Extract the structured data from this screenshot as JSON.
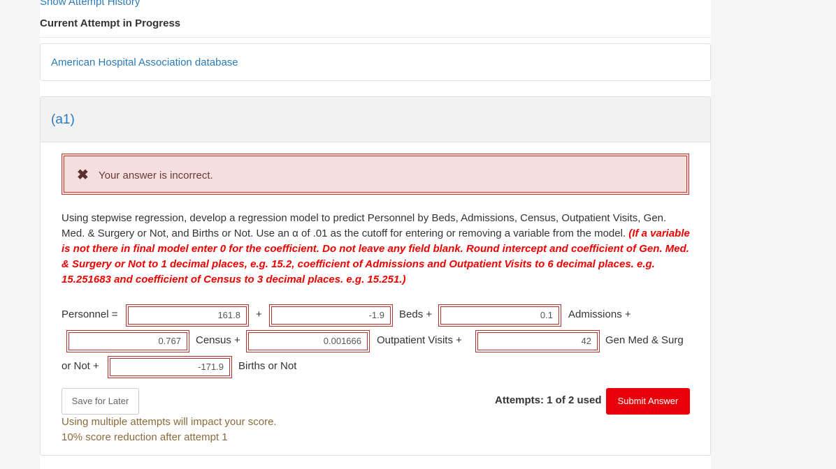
{
  "header": {
    "history_link": "Show Attempt History",
    "attempt_title": "Current Attempt in Progress"
  },
  "resource": {
    "link_label": "American Hospital Association database"
  },
  "question": {
    "part_label": "(a1)",
    "alert_icon": "close-icon",
    "alert_text": "Your answer is incorrect.",
    "prompt_text": "Using stepwise regression, develop a regression model to predict Personnel by Beds, Admissions, Census, Outpatient Visits, Gen. Med. & Surgery or Not, and Births or Not. Use an α of .01 as the cutoff for entering or removing a variable from the model.",
    "instruction_text": "(If a variable is not there in final model enter 0 for the coefficient. Do not leave any field blank. Round intercept and coefficient of Gen. Med. & Surgery or Not to 1 decimal places, e.g. 15.2, coefficient of Admissions and Outpatient Visits to 6 decimal places. e.g. 15.251683 and coefficient of Census to 3 decimal places. e.g. 15.251.)"
  },
  "equation": {
    "label_personnel": "Personnel =",
    "intercept_value": "161.8",
    "label_plus": "+",
    "beds_value": "-1.9",
    "label_beds": "Beds +",
    "admissions_value": "0.1",
    "label_admissions": "Admissions +",
    "census_value": "0.767",
    "label_census": "Census +",
    "outpatient_value": "0.001666",
    "label_outpatient": "Outpatient Visits +",
    "genmed_value": "42",
    "label_genmed": "Gen Med & Surg",
    "label_or_not": "or Not +",
    "births_value": "-171.9",
    "label_births": "Births or Not"
  },
  "actions": {
    "save_label": "Save for Later",
    "attempts_text": "Attempts: 1 of 2 used",
    "submit_label": "Submit Answer"
  },
  "notes": {
    "line1": "Using multiple attempts will impact your score.",
    "line2": "10% score reduction after attempt 1"
  },
  "colors": {
    "link": "#2a7ab8",
    "error": "#c0392b",
    "submit": "#e8000a"
  }
}
